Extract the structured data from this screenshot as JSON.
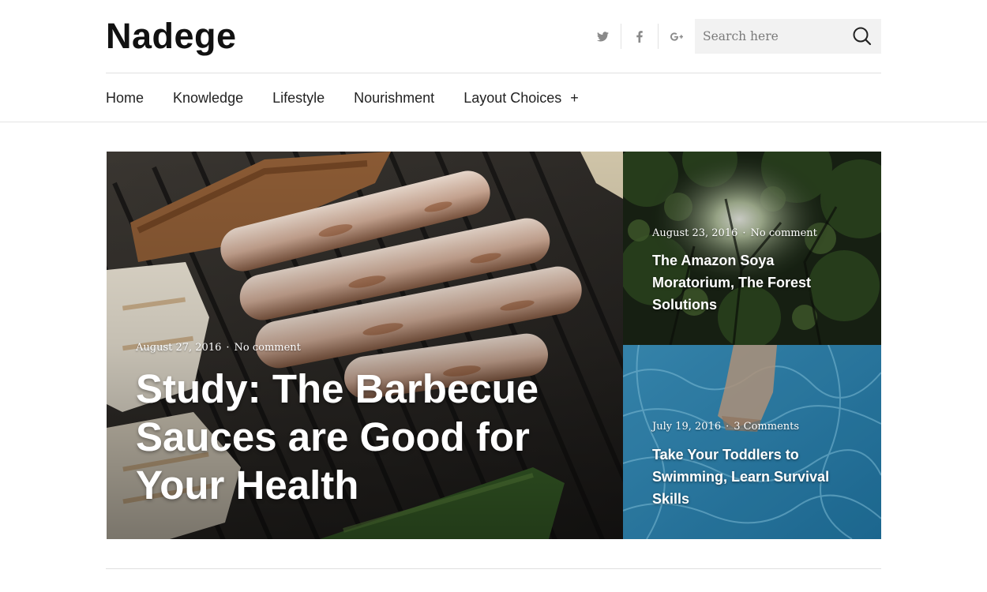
{
  "site": {
    "title": "Nadege"
  },
  "social": [
    {
      "icon": "twitter-icon",
      "glyph": "🐦"
    },
    {
      "icon": "facebook-icon",
      "glyph": "f"
    },
    {
      "icon": "google-plus-icon",
      "glyph": "G+"
    }
  ],
  "search": {
    "placeholder": "Search here",
    "value": ""
  },
  "nav": {
    "items": [
      "Home",
      "Knowledge",
      "Lifestyle",
      "Nourishment",
      "Layout Choices"
    ],
    "expand_glyph": "+"
  },
  "featured": {
    "main": {
      "date": "August 27, 2016",
      "comments": "No comment",
      "title": "Study: The Barbecue Sauces are Good for Your Health"
    },
    "side": [
      {
        "date": "August 23, 2016",
        "comments": "No comment",
        "title": "The Amazon Soya Moratorium, The Forest Solutions"
      },
      {
        "date": "July 19, 2016",
        "comments": "3 Comments",
        "title": "Take Your Toddlers to Swimming, Learn Survival Skills"
      }
    ],
    "separator": "·"
  },
  "colors": {
    "background": "#ffffff",
    "search_bg": "#f2f2f2",
    "rule": "#e0e0e0",
    "text": "#222222"
  }
}
